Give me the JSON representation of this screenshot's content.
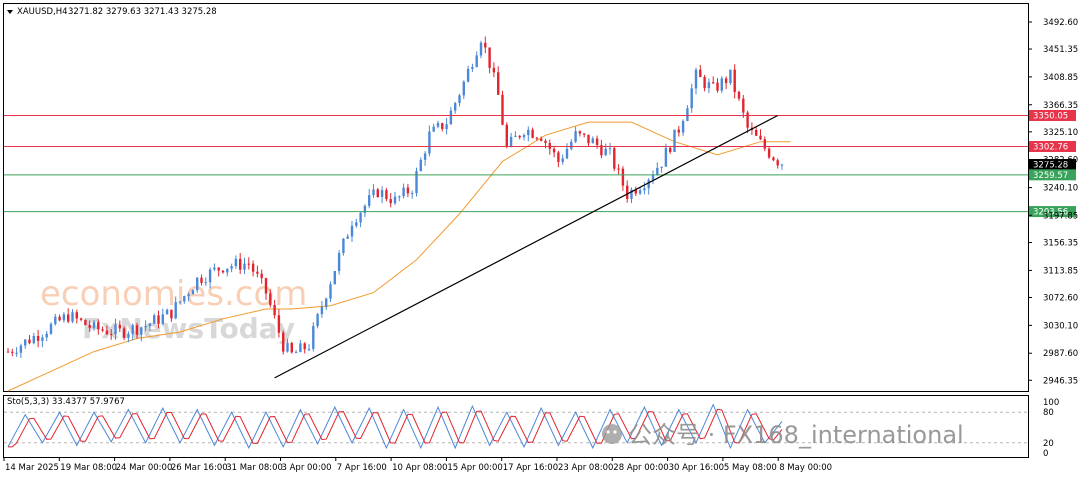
{
  "chart_data": {
    "type": "candlestick",
    "header": {
      "symbol": "XAUUSD,H4",
      "ohlc_text": "3271.82 3279.63 3271.43 3275.28",
      "indicator_label": "Sto(5,3,3) 33.4377 57.9767"
    },
    "price_axis": {
      "ylim": [
        2930,
        3520
      ],
      "ticks": [
        "3492.60",
        "3451.35",
        "3408.85",
        "3366.35",
        "3325.10",
        "3282.60",
        "3240.10",
        "3197.85",
        "3156.35",
        "3113.85",
        "3072.60",
        "3030.10",
        "2987.60",
        "2946.35"
      ]
    },
    "stoch_axis": {
      "ylim": [
        0,
        100
      ],
      "ticks": [
        "100",
        "80",
        "20",
        "0"
      ],
      "levels": [
        80,
        20
      ]
    },
    "x_axis": {
      "labels": [
        "14 Mar 2025",
        "19 Mar 08:00",
        "24 Mar 00:00",
        "26 Mar 16:00",
        "31 Mar 08:00",
        "3 Apr 00:00",
        "7 Apr 16:00",
        "10 Apr 08:00",
        "15 Apr 00:00",
        "17 Apr 16:00",
        "23 Apr 08:00",
        "28 Apr 00:00",
        "30 Apr 16:00",
        "5 May 08:00",
        "8 May 00:00"
      ]
    },
    "horizontal_levels": [
      {
        "price": 3350.05,
        "label": "3350.05",
        "color": "#e8344b"
      },
      {
        "price": 3302.76,
        "label": "3302.76",
        "color": "#e8344b"
      },
      {
        "price": 3275.28,
        "label": "3275.28",
        "color": "#000000"
      },
      {
        "price": 3259.57,
        "label": "3259.57",
        "color": "#3aa35b"
      },
      {
        "price": 3203.56,
        "label": "3203.56",
        "color": "#3aa35b"
      }
    ],
    "trendline": {
      "from": {
        "bar": 62,
        "price": 2950
      },
      "to": {
        "bar": 179,
        "price": 3350
      }
    },
    "moving_average": {
      "name": "",
      "color": "#f39a2e",
      "points": [
        [
          0,
          2930
        ],
        [
          10,
          2960
        ],
        [
          20,
          2990
        ],
        [
          30,
          3010
        ],
        [
          40,
          3020
        ],
        [
          50,
          3040
        ],
        [
          60,
          3055
        ],
        [
          66,
          3055
        ],
        [
          75,
          3060
        ],
        [
          85,
          3080
        ],
        [
          95,
          3130
        ],
        [
          105,
          3200
        ],
        [
          115,
          3280
        ],
        [
          125,
          3320
        ],
        [
          135,
          3340
        ],
        [
          145,
          3340
        ],
        [
          155,
          3310
        ],
        [
          165,
          3290
        ],
        [
          175,
          3310
        ],
        [
          182,
          3310
        ]
      ]
    },
    "candle_anchors": [
      [
        0,
        2990
      ],
      [
        8,
        3020
      ],
      [
        14,
        3045
      ],
      [
        20,
        3025
      ],
      [
        26,
        3020
      ],
      [
        32,
        3030
      ],
      [
        38,
        3050
      ],
      [
        44,
        3100
      ],
      [
        50,
        3120
      ],
      [
        56,
        3125
      ],
      [
        60,
        3080
      ],
      [
        64,
        3000
      ],
      [
        66,
        2985
      ],
      [
        70,
        3000
      ],
      [
        74,
        3080
      ],
      [
        80,
        3190
      ],
      [
        86,
        3235
      ],
      [
        90,
        3220
      ],
      [
        94,
        3240
      ],
      [
        98,
        3320
      ],
      [
        102,
        3340
      ],
      [
        106,
        3400
      ],
      [
        110,
        3470
      ],
      [
        112,
        3430
      ],
      [
        114,
        3380
      ],
      [
        116,
        3300
      ],
      [
        120,
        3330
      ],
      [
        124,
        3320
      ],
      [
        128,
        3280
      ],
      [
        132,
        3320
      ],
      [
        136,
        3310
      ],
      [
        140,
        3290
      ],
      [
        144,
        3230
      ],
      [
        148,
        3250
      ],
      [
        152,
        3280
      ],
      [
        156,
        3330
      ],
      [
        160,
        3410
      ],
      [
        164,
        3390
      ],
      [
        168,
        3410
      ],
      [
        172,
        3330
      ],
      [
        176,
        3300
      ],
      [
        180,
        3275
      ]
    ],
    "candle_style": {
      "up": "#4b88d8",
      "down": "#e2242f"
    },
    "stochastic": {
      "main_color": "#4b88d8",
      "signal_color": "#e2242f",
      "turning_points": [
        [
          0,
          12
        ],
        [
          4,
          75
        ],
        [
          8,
          20
        ],
        [
          12,
          80
        ],
        [
          16,
          15
        ],
        [
          20,
          80
        ],
        [
          24,
          22
        ],
        [
          28,
          85
        ],
        [
          32,
          20
        ],
        [
          36,
          88
        ],
        [
          40,
          20
        ],
        [
          44,
          85
        ],
        [
          48,
          15
        ],
        [
          52,
          80
        ],
        [
          56,
          10
        ],
        [
          60,
          80
        ],
        [
          64,
          12
        ],
        [
          68,
          85
        ],
        [
          72,
          18
        ],
        [
          76,
          90
        ],
        [
          80,
          20
        ],
        [
          84,
          88
        ],
        [
          88,
          10
        ],
        [
          92,
          85
        ],
        [
          96,
          10
        ],
        [
          100,
          90
        ],
        [
          104,
          10
        ],
        [
          108,
          92
        ],
        [
          112,
          15
        ],
        [
          116,
          80
        ],
        [
          120,
          12
        ],
        [
          124,
          88
        ],
        [
          128,
          15
        ],
        [
          132,
          80
        ],
        [
          136,
          10
        ],
        [
          140,
          85
        ],
        [
          144,
          20
        ],
        [
          148,
          90
        ],
        [
          152,
          15
        ],
        [
          156,
          85
        ],
        [
          160,
          20
        ],
        [
          164,
          95
        ],
        [
          168,
          10
        ],
        [
          172,
          85
        ],
        [
          176,
          20
        ],
        [
          180,
          62
        ]
      ]
    }
  },
  "watermarks": {
    "brand_top": "economies.com",
    "brand_bottom": "FxNewsToday",
    "account": "公众号 · FX168_international"
  }
}
